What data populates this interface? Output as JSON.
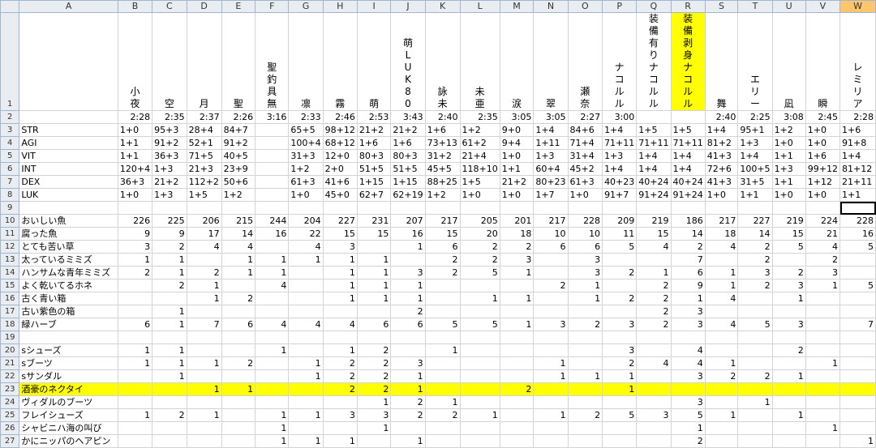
{
  "columns": [
    "A",
    "B",
    "C",
    "D",
    "E",
    "F",
    "G",
    "H",
    "I",
    "J",
    "K",
    "L",
    "M",
    "N",
    "O",
    "P",
    "Q",
    "R",
    "S",
    "T",
    "U",
    "V",
    "W"
  ],
  "selected_column_index": 22,
  "names": [
    "",
    "小夜",
    "空",
    "月",
    "聖",
    "聖釣具無",
    "凛",
    "霧",
    "萌",
    "萌LUK80",
    "詠未",
    "未亜",
    "涙",
    "翠",
    "瀬奈",
    "ナコルル",
    "装備有りナコルル",
    "装備剥身ナコルル",
    "舞",
    "エリー",
    "凪",
    "瞬",
    "レミリア"
  ],
  "highlight_name_index": 17,
  "times": [
    "",
    "2:28",
    "2:35",
    "2:37",
    "2:26",
    "3:16",
    "2:33",
    "2:46",
    "2:53",
    "3:43",
    "2:40",
    "2:35",
    "3:05",
    "3:05",
    "2:27",
    "3:00",
    "",
    "",
    "2:40",
    "2:25",
    "3:08",
    "2:45",
    "2:28"
  ],
  "stats": [
    [
      "STR",
      "1+0",
      "95+3",
      "28+4",
      "84+7",
      "",
      "65+5",
      "98+12",
      "21+2",
      "21+2",
      "1+6",
      "1+2",
      "9+0",
      "1+4",
      "84+6",
      "1+4",
      "1+5",
      "1+5",
      "1+4",
      "95+1",
      "1+2",
      "1+0",
      "1+6"
    ],
    [
      "AGI",
      "1+1",
      "91+2",
      "52+1",
      "91+2",
      "",
      "100+4",
      "68+12",
      "1+6",
      "1+6",
      "73+13",
      "61+2",
      "9+4",
      "1+11",
      "71+4",
      "71+11",
      "71+11",
      "71+11",
      "81+2",
      "1+3",
      "1+0",
      "1+0",
      "91+8"
    ],
    [
      "VIT",
      "1+1",
      "36+3",
      "71+5",
      "40+5",
      "",
      "31+3",
      "12+0",
      "80+3",
      "80+3",
      "31+2",
      "21+4",
      "1+0",
      "1+3",
      "31+4",
      "1+3",
      "1+4",
      "1+4",
      "41+3",
      "1+4",
      "1+1",
      "1+6",
      "1+4"
    ],
    [
      "INT",
      "120+4",
      "1+3",
      "21+3",
      "23+9",
      "",
      "1+2",
      "2+0",
      "51+5",
      "51+5",
      "45+5",
      "118+10",
      "1+1",
      "60+4",
      "45+2",
      "1+4",
      "1+4",
      "1+4",
      "72+6",
      "100+5",
      "1+3",
      "99+12",
      "81+12"
    ],
    [
      "DEX",
      "36+3",
      "21+2",
      "112+2",
      "50+6",
      "",
      "61+3",
      "41+6",
      "1+15",
      "1+15",
      "88+25",
      "1+5",
      "21+2",
      "80+23",
      "61+3",
      "40+23",
      "40+24",
      "40+24",
      "41+3",
      "31+5",
      "1+1",
      "1+12",
      "21+11"
    ],
    [
      "LUK",
      "1+0",
      "1+3",
      "1+5",
      "1+2",
      "",
      "1+0",
      "45+0",
      "62+7",
      "62+19",
      "1+2",
      "1+0",
      "1+0",
      "1+7",
      "1+0",
      "91+7",
      "91+24",
      "91+24",
      "1+0",
      "1+1",
      "1+0",
      "1+0",
      "1+1"
    ]
  ],
  "cursor": {
    "row": 9,
    "col": 22
  },
  "items": [
    {
      "row": 10,
      "label": "おいしい魚",
      "values": [
        "226",
        "225",
        "206",
        "215",
        "244",
        "204",
        "227",
        "231",
        "207",
        "217",
        "205",
        "201",
        "217",
        "228",
        "209",
        "219",
        "186",
        "217",
        "227",
        "219",
        "224",
        "228"
      ]
    },
    {
      "row": 11,
      "label": "腐った魚",
      "values": [
        "9",
        "9",
        "17",
        "14",
        "16",
        "22",
        "15",
        "15",
        "16",
        "15",
        "20",
        "18",
        "10",
        "10",
        "11",
        "15",
        "14",
        "18",
        "14",
        "15",
        "21",
        "16"
      ]
    },
    {
      "row": 12,
      "label": "とても苦い草",
      "values": [
        "3",
        "2",
        "4",
        "4",
        "",
        "4",
        "3",
        "",
        "1",
        "6",
        "2",
        "2",
        "6",
        "6",
        "5",
        "4",
        "2",
        "4",
        "2",
        "5",
        "4",
        "5"
      ]
    },
    {
      "row": 13,
      "label": "太っているミミズ",
      "values": [
        "1",
        "1",
        "",
        "1",
        "1",
        "1",
        "1",
        "1",
        "",
        "2",
        "2",
        "3",
        "",
        "3",
        "",
        "",
        "7",
        "",
        "2",
        "",
        "2",
        ""
      ]
    },
    {
      "row": 14,
      "label": "ハンサムな青年ミミズ",
      "values": [
        "2",
        "1",
        "2",
        "1",
        "1",
        "",
        "1",
        "1",
        "3",
        "2",
        "5",
        "1",
        "",
        "3",
        "2",
        "1",
        "6",
        "1",
        "3",
        "2",
        "3",
        ""
      ]
    },
    {
      "row": 15,
      "label": "よく乾いてるホネ",
      "values": [
        "",
        "2",
        "1",
        "",
        "4",
        "",
        "1",
        "1",
        "1",
        "",
        "",
        "",
        "2",
        "1",
        "",
        "2",
        "9",
        "1",
        "2",
        "3",
        "1",
        "5"
      ]
    },
    {
      "row": 16,
      "label": "古く青い箱",
      "values": [
        "",
        "",
        "1",
        "2",
        "",
        "",
        "1",
        "1",
        "1",
        "",
        "1",
        "1",
        "",
        "1",
        "2",
        "2",
        "1",
        "4",
        "",
        "1",
        "",
        ""
      ]
    },
    {
      "row": 17,
      "label": "古い紫色の箱",
      "values": [
        "",
        "1",
        "",
        "",
        "",
        "",
        "",
        "",
        "2",
        "",
        "",
        "",
        "",
        "",
        "",
        "2",
        "3",
        "",
        "",
        "",
        "",
        ""
      ]
    },
    {
      "row": 18,
      "label": "緑ハーブ",
      "values": [
        "6",
        "1",
        "7",
        "6",
        "4",
        "4",
        "4",
        "6",
        "6",
        "5",
        "5",
        "1",
        "3",
        "2",
        "3",
        "2",
        "3",
        "4",
        "5",
        "3",
        "",
        "7"
      ]
    },
    {
      "row": 19,
      "label": "",
      "values": [
        "",
        "",
        "",
        "",
        "",
        "",
        "",
        "",
        "",
        "",
        "",
        "",
        "",
        "",
        "",
        "",
        "",
        "",
        "",
        "",
        "",
        ""
      ]
    },
    {
      "row": 20,
      "label": "sシューズ",
      "values": [
        "1",
        "1",
        "",
        "",
        "1",
        "",
        "1",
        "2",
        "",
        "1",
        "",
        "",
        "",
        "",
        "3",
        "",
        "4",
        "",
        "",
        "2",
        "",
        ""
      ]
    },
    {
      "row": 21,
      "label": "sブーツ",
      "values": [
        "1",
        "1",
        "1",
        "2",
        "",
        "1",
        "2",
        "2",
        "3",
        "",
        "",
        "",
        "1",
        "",
        "2",
        "4",
        "4",
        "1",
        "",
        "",
        "1",
        ""
      ]
    },
    {
      "row": 22,
      "label": "sサンダル",
      "values": [
        "",
        "1",
        "",
        "",
        "",
        "1",
        "2",
        "2",
        "1",
        "",
        "",
        "",
        "1",
        "1",
        "1",
        "",
        "3",
        "2",
        "2",
        "1",
        "",
        ""
      ]
    },
    {
      "row": 23,
      "label": "酒豪のネクタイ",
      "values": [
        "",
        "",
        "1",
        "1",
        "",
        "",
        "2",
        "2",
        "1",
        "",
        "",
        "2",
        "",
        "",
        "1",
        "",
        "",
        "",
        "",
        "",
        "",
        ""
      ]
    },
    {
      "row": 24,
      "label": "ヴィダルのブーツ",
      "values": [
        "",
        "",
        "",
        "",
        "",
        "",
        "",
        "1",
        "2",
        "1",
        "",
        "",
        "",
        "",
        "",
        "",
        "3",
        "",
        "1",
        "",
        "",
        ""
      ]
    },
    {
      "row": 25,
      "label": "フレイシューズ",
      "values": [
        "1",
        "2",
        "1",
        "",
        "1",
        "1",
        "3",
        "3",
        "2",
        "2",
        "1",
        "",
        "1",
        "2",
        "5",
        "3",
        "5",
        "1",
        "",
        "1",
        "",
        ""
      ]
    },
    {
      "row": 26,
      "label": "シャビニハ海の叫び",
      "values": [
        "",
        "",
        "",
        "",
        "1",
        "",
        "",
        "1",
        "",
        "",
        "",
        "",
        "",
        "",
        "",
        "",
        "1",
        "",
        "",
        "",
        "1",
        ""
      ]
    },
    {
      "row": 27,
      "label": "かにニッパのヘアピン",
      "values": [
        "",
        "",
        "",
        "",
        "1",
        "1",
        "1",
        "",
        "1",
        "",
        "",
        "",
        "",
        "",
        "",
        "",
        "2",
        "",
        "",
        "",
        "",
        "1"
      ]
    }
  ],
  "highlight_row": 23
}
